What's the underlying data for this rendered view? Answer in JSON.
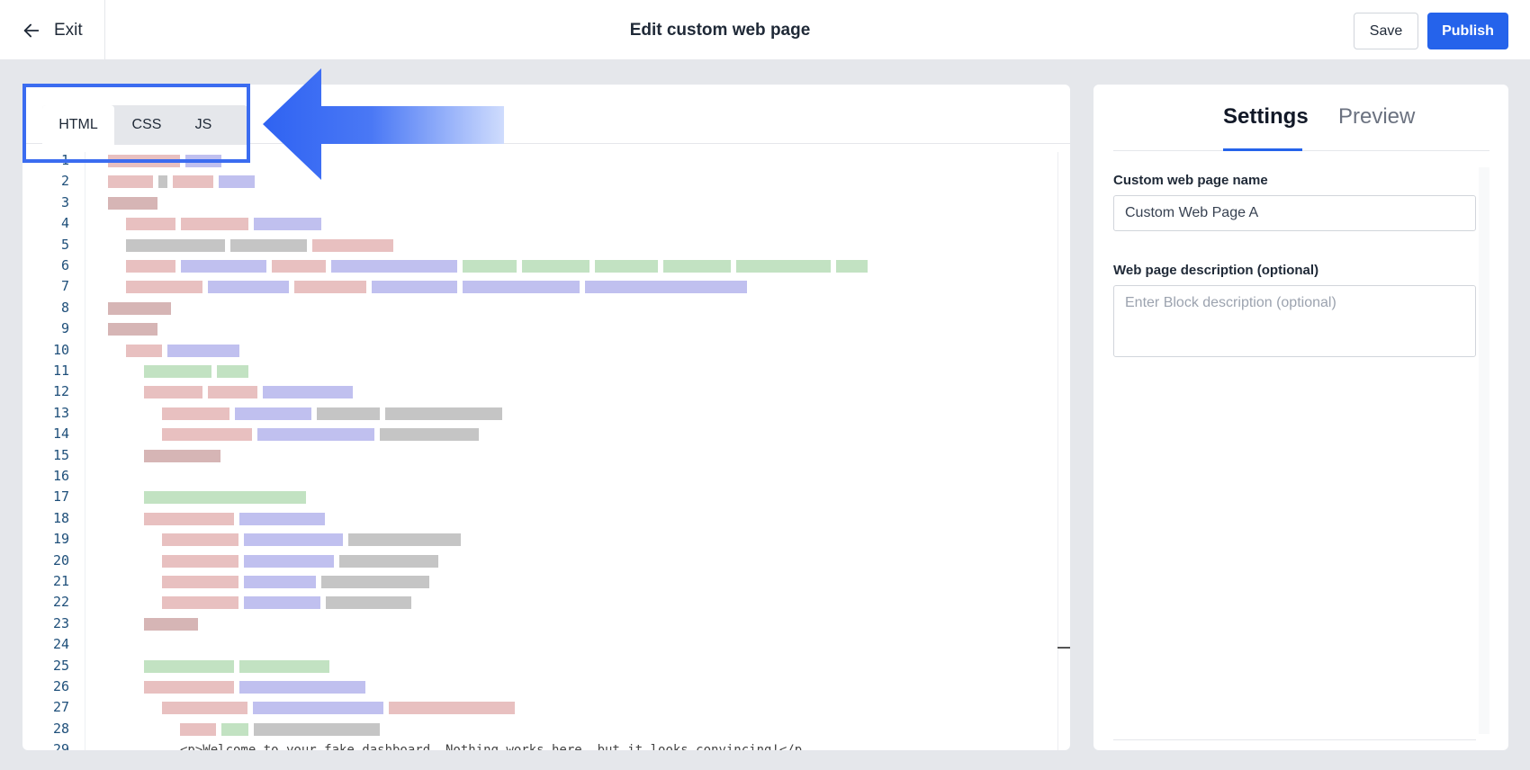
{
  "header": {
    "exit_label": "Exit",
    "title": "Edit custom web page",
    "save_label": "Save",
    "publish_label": "Publish"
  },
  "editor": {
    "tabs": [
      "HTML",
      "CSS",
      "JS"
    ],
    "active_tab": "HTML",
    "line_numbers": [
      "1",
      "2",
      "3",
      "4",
      "5",
      "6",
      "7",
      "8",
      "9",
      "10",
      "11",
      "12",
      "13",
      "14",
      "15",
      "16",
      "17",
      "18",
      "19",
      "20",
      "21",
      "22",
      "23",
      "24",
      "25",
      "26",
      "27",
      "28",
      "29"
    ],
    "visible_code_fragment": "<p>Welcome to your fake dashboard. Nothing works here, but it looks convincing!</p"
  },
  "settings": {
    "tabs": {
      "settings": "Settings",
      "preview": "Preview"
    },
    "name_label": "Custom web page name",
    "name_value": "Custom Web Page A",
    "description_label": "Web page description (optional)",
    "description_placeholder": "Enter Block description (optional)"
  },
  "colors": {
    "accent": "#2563eb",
    "highlight": "#3b6cf0",
    "line_number": "#1e4f7a"
  }
}
